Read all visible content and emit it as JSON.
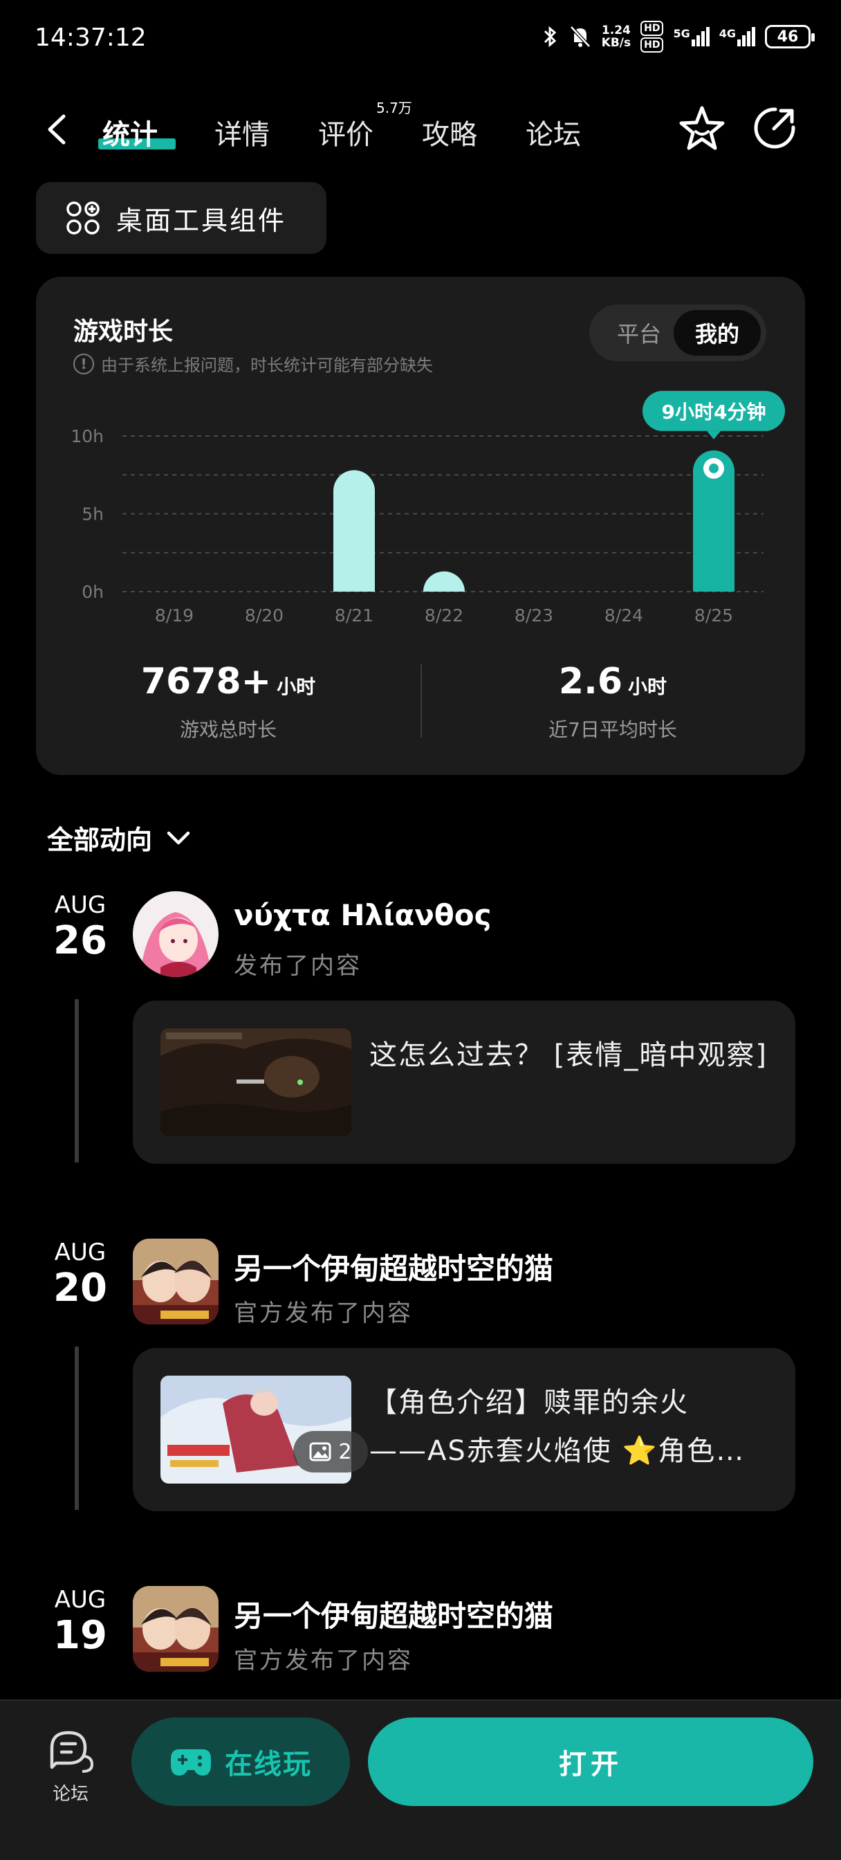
{
  "status_bar": {
    "time": "14:37:12",
    "net_speed_value": "1.24",
    "net_speed_unit": "KB/s",
    "hd1": "HD",
    "sig1": "5G",
    "sig2": "4G",
    "battery": "46"
  },
  "nav": {
    "tabs": [
      {
        "label": "统计",
        "active": true
      },
      {
        "label": "详情"
      },
      {
        "label": "评价"
      },
      {
        "label": "攻略"
      },
      {
        "label": "论坛"
      }
    ],
    "review_badge": "5.7万"
  },
  "widget_button": {
    "label": "桌面工具组件"
  },
  "playtime_card": {
    "title": "游戏时长",
    "note": "由于系统上报问题，时长统计可能有部分缺失",
    "toggle": {
      "platform": "平台",
      "mine": "我的",
      "selected": "mine"
    },
    "highlight_label": "9小时4分钟",
    "total": {
      "value": "7678+",
      "unit": "小时",
      "label": "游戏总时长"
    },
    "average": {
      "value": "2.6",
      "unit": "小时",
      "label": "近7日平均时长"
    }
  },
  "chart_data": {
    "type": "bar",
    "categories": [
      "8/19",
      "8/20",
      "8/21",
      "8/22",
      "8/23",
      "8/24",
      "8/25"
    ],
    "values": [
      0,
      0,
      7.8,
      1.3,
      0,
      0,
      9.07
    ],
    "ylim": [
      0,
      10
    ],
    "yticks": [
      "0h",
      "5h",
      "10h"
    ],
    "colors": {
      "normal": "#b5f1ea",
      "highlight": "#17b3a3"
    },
    "highlight_index": 6,
    "grid": true
  },
  "feed": {
    "header": "全部动向",
    "items": [
      {
        "month": "AUG",
        "day": "26",
        "author": "νύχτα Ηλίανθος",
        "action": "发布了内容",
        "text": "这怎么过去？ [表情_暗中观察]"
      },
      {
        "month": "AUG",
        "day": "20",
        "author": "另一个伊甸超越时空的猫",
        "action": "官方发布了内容",
        "text_line1": "【角色介绍】赎罪的余火",
        "text_line2": "——AS赤套火焰使 ⭐角色…",
        "image_count": "2"
      },
      {
        "month": "AUG",
        "day": "19",
        "author": "另一个伊甸超越时空的猫",
        "action": "官方发布了内容"
      }
    ]
  },
  "bottom_bar": {
    "forum_label": "论坛",
    "play_online_label": "在线玩",
    "open_label": "打开"
  }
}
